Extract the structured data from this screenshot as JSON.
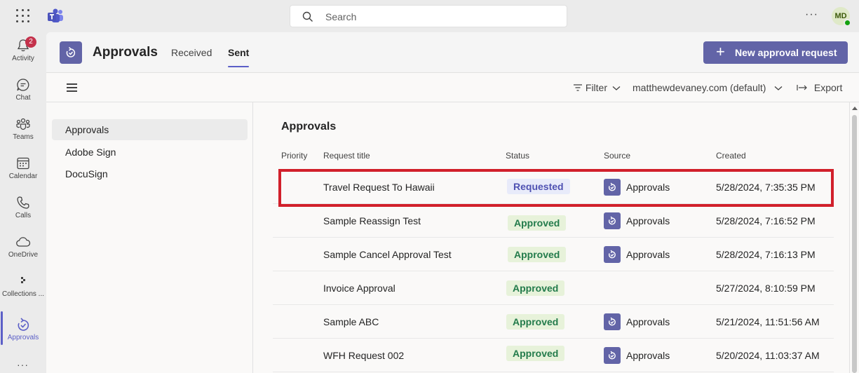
{
  "topbar": {
    "search_placeholder": "Search",
    "more_label": "···",
    "avatar_initials": "MD"
  },
  "rail": {
    "items": [
      {
        "label": "Activity",
        "badge": "2"
      },
      {
        "label": "Chat"
      },
      {
        "label": "Teams"
      },
      {
        "label": "Calendar"
      },
      {
        "label": "Calls"
      },
      {
        "label": "OneDrive"
      },
      {
        "label": "Collections ..."
      },
      {
        "label": "Approvals"
      }
    ],
    "more_label": "···"
  },
  "header": {
    "title": "Approvals",
    "tabs": [
      "Received",
      "Sent"
    ],
    "active_tab": "Sent",
    "new_button": "New approval request"
  },
  "toolbar": {
    "filter": "Filter",
    "environment": "matthewdevaney.com (default)",
    "export": "Export"
  },
  "nav": {
    "items": [
      "Approvals",
      "Adobe Sign",
      "DocuSign"
    ],
    "active": "Approvals"
  },
  "main": {
    "title": "Approvals",
    "columns": [
      "Priority",
      "Request title",
      "Status",
      "Source",
      "Created"
    ],
    "rows": [
      {
        "title": "Travel Request To Hawaii",
        "status": "Requested",
        "source": "Approvals",
        "created": "5/28/2024, 7:35:35 PM"
      },
      {
        "title": "Sample Reassign Test",
        "status": "Approved",
        "source": "Approvals",
        "created": "5/28/2024, 7:16:52 PM"
      },
      {
        "title": "Sample Cancel Approval Test",
        "status": "Approved",
        "source": "Approvals",
        "created": "5/28/2024, 7:16:13 PM"
      },
      {
        "title": "Invoice Approval",
        "status": "Approved",
        "source": "",
        "created": "5/27/2024, 8:10:59 PM"
      },
      {
        "title": "Sample ABC",
        "status": "Approved",
        "source": "Approvals",
        "created": "5/21/2024, 11:51:56 AM"
      },
      {
        "title": "WFH Request 002",
        "status": "Approved",
        "source": "Approvals",
        "created": "5/20/2024, 11:03:37 AM"
      }
    ]
  },
  "colors": {
    "accent": "#5b5fc7",
    "brand": "#6264a7",
    "requested": "#4f52b2",
    "approved": "#237b4b",
    "highlight": "#d1202b"
  }
}
